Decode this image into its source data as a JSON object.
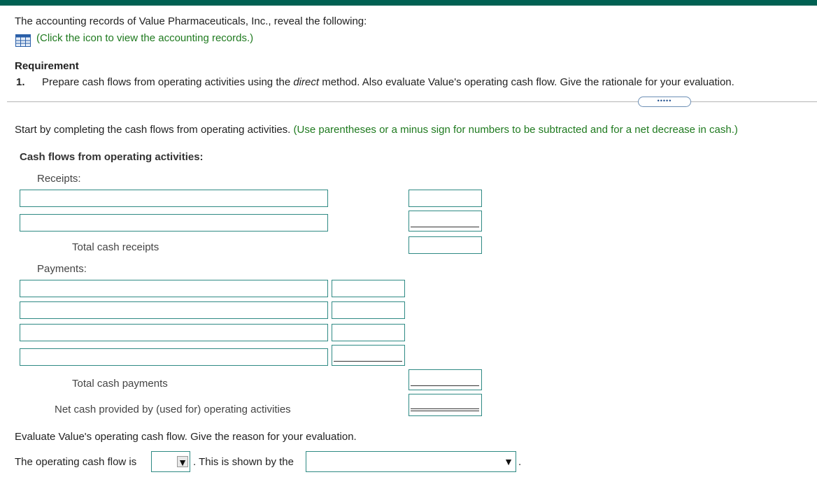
{
  "intro": {
    "text": "The accounting records of Value Pharmaceuticals, Inc., reveal the following:",
    "link_text": "(Click the icon to view the accounting records.)"
  },
  "requirement": {
    "heading": "Requirement",
    "number": "1.",
    "text_before": "Prepare cash flows from operating activities using the ",
    "text_italic": "direct",
    "text_after": " method. Also evaluate Value's operating cash flow. Give the rationale for your evaluation."
  },
  "expand_control": "•••••",
  "instructions": {
    "text": "Start by completing the cash flows from operating activities.",
    "hint": "(Use parentheses or a minus sign for numbers to be subtracted and for a net decrease in cash.)"
  },
  "statement": {
    "heading": "Cash flows from operating activities:",
    "receipts_label": "Receipts:",
    "total_receipts_label": "Total cash receipts",
    "payments_label": "Payments:",
    "total_payments_label": "Total cash payments",
    "net_label": "Net cash provided by (used for) operating activities"
  },
  "evaluation": {
    "question": "Evaluate Value's operating cash flow. Give the reason for your evaluation.",
    "sentence_start": "The operating cash flow is",
    "sentence_mid": ". This is shown by the",
    "sentence_end": ".",
    "dropdown1_value": "",
    "dropdown2_value": ""
  },
  "colors": {
    "top_bar": "#006152",
    "input_border": "#2f8a84",
    "hint_green": "#1f7a1f"
  },
  "icons": {
    "records": "grid-table-icon",
    "dropdown": "triangle-down-icon"
  }
}
